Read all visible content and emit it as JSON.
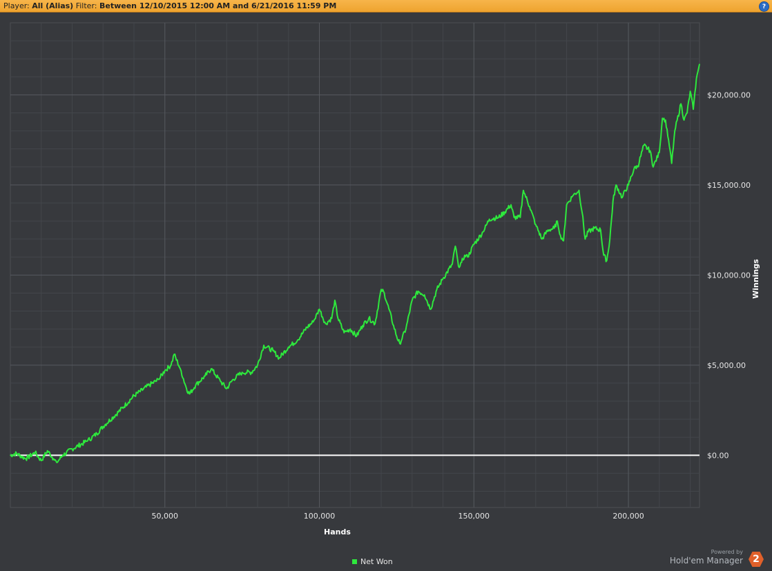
{
  "header": {
    "player_label": "Player:",
    "player_value": "All (Alias)",
    "filter_label": "Filter:",
    "filter_value": "Between 12/10/2015 12:00 AM and 6/21/2016 11:59 PM",
    "help_icon": "?"
  },
  "branding": {
    "powered_by": "Powered by",
    "product": "Hold'em Manager",
    "version_badge": "2"
  },
  "colors": {
    "background": "#37393d",
    "grid": "#4c4f54",
    "series": "#2ee83d",
    "zero_line": "#ffffff",
    "header_bar": "#f2aa3a"
  },
  "chart_data": {
    "type": "line",
    "xlabel": "Hands",
    "ylabel": "Winnings",
    "xlim": [
      0,
      223000
    ],
    "ylim": [
      -2900,
      24000
    ],
    "x_ticks": [
      50000,
      100000,
      150000,
      200000
    ],
    "x_tick_labels": [
      "50,000",
      "100,000",
      "150,000",
      "200,000"
    ],
    "y_ticks": [
      0,
      5000,
      10000,
      15000,
      20000
    ],
    "y_tick_labels": [
      "$0.00",
      "$5,000.00",
      "$10,000.00",
      "$15,000.00",
      "$20,000.00"
    ],
    "y_axis_side": "right",
    "grid": true,
    "legend_position": "bottom-center",
    "reference_line": {
      "y": 0
    },
    "series": [
      {
        "name": "Net Won",
        "x": [
          0,
          2000,
          5000,
          8000,
          10000,
          12000,
          14000,
          15000,
          17000,
          20000,
          25000,
          28000,
          30000,
          35000,
          40000,
          45000,
          48000,
          50000,
          52000,
          53000,
          55000,
          57000,
          58000,
          60000,
          63000,
          65000,
          68000,
          70000,
          72000,
          75000,
          78000,
          80000,
          82000,
          83000,
          85000,
          87000,
          90000,
          93000,
          96000,
          98000,
          100000,
          102000,
          104000,
          105000,
          106000,
          108000,
          110000,
          112000,
          114000,
          116000,
          118000,
          120000,
          121000,
          122000,
          124000,
          125000,
          126000,
          128000,
          130000,
          132000,
          134000,
          136000,
          138000,
          140000,
          143000,
          144000,
          145000,
          146000,
          147000,
          148000,
          150000,
          153000,
          155000,
          158000,
          160000,
          162000,
          163000,
          165000,
          166000,
          168000,
          170000,
          172000,
          174000,
          176000,
          177000,
          178000,
          179000,
          180000,
          182000,
          184000,
          185000,
          186000,
          187000,
          189000,
          191000,
          192000,
          193000,
          194000,
          195000,
          196000,
          198000,
          199000,
          200000,
          202000,
          203000,
          205000,
          207000,
          208000,
          210000,
          211000,
          212000,
          213000,
          214000,
          215000,
          217000,
          218000,
          219000,
          220000,
          221000,
          222000,
          223000
        ],
        "y": [
          0,
          100,
          -200,
          150,
          -300,
          250,
          -200,
          -400,
          0,
          350,
          800,
          1200,
          1600,
          2400,
          3300,
          3900,
          4200,
          4700,
          5000,
          5600,
          4800,
          3700,
          3400,
          3900,
          4400,
          4800,
          4100,
          3700,
          4200,
          4600,
          4600,
          5000,
          6100,
          6000,
          5800,
          5400,
          6000,
          6400,
          7100,
          7400,
          8100,
          7300,
          7600,
          8600,
          7600,
          6800,
          7000,
          6600,
          7200,
          7600,
          7300,
          9200,
          9000,
          8400,
          7200,
          6600,
          6200,
          7000,
          8600,
          9100,
          8900,
          8100,
          9200,
          9800,
          10600,
          11600,
          10500,
          10700,
          11100,
          11000,
          11700,
          12400,
          13100,
          13200,
          13500,
          13900,
          13200,
          13200,
          14700,
          13800,
          12800,
          12000,
          12500,
          12600,
          13000,
          12200,
          11900,
          13900,
          14400,
          14700,
          13500,
          12000,
          12400,
          12600,
          12500,
          11100,
          10800,
          12000,
          14100,
          15000,
          14300,
          14700,
          15000,
          16000,
          16000,
          17200,
          16900,
          16000,
          16800,
          18700,
          18600,
          17500,
          16200,
          18000,
          19500,
          18600,
          19000,
          20200,
          19200,
          20900,
          21700
        ]
      }
    ]
  }
}
